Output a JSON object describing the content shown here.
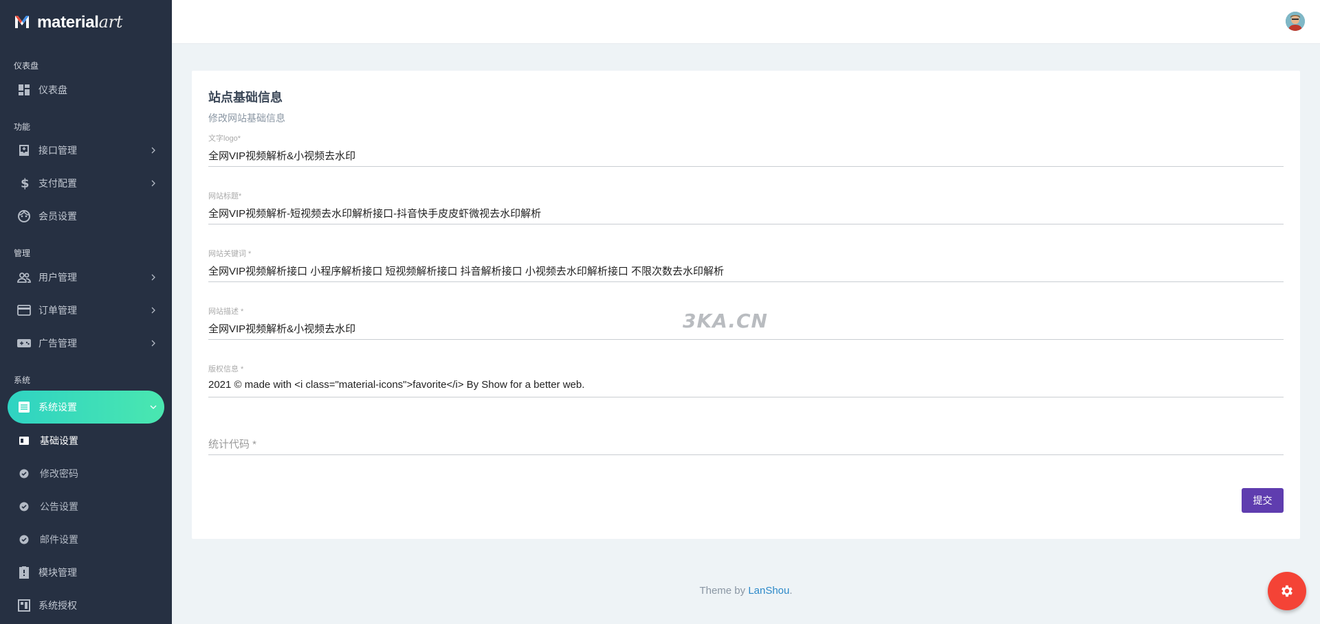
{
  "brand": {
    "name_bold": "material",
    "name_italic": "art"
  },
  "sidebar": {
    "sections": {
      "dashboard": "仪表盘",
      "features": "功能",
      "manage": "管理",
      "system": "系统"
    },
    "items": {
      "dashboard": "仪表盘",
      "api": "接口管理",
      "payment": "支付配置",
      "member": "会员设置",
      "users": "用户管理",
      "orders": "订单管理",
      "ads": "广告管理",
      "system_settings": "系统设置",
      "basic": "基础设置",
      "password": "修改密码",
      "notice": "公告设置",
      "mail": "邮件设置",
      "modules": "模块管理",
      "license": "系统授权"
    }
  },
  "card": {
    "title": "站点基础信息",
    "subtitle": "修改网站基础信息",
    "fields": {
      "logo": {
        "label": "文字logo*",
        "value": "全网VIP视频解析&小视频去水印"
      },
      "title": {
        "label": "网站标题*",
        "value": "全网VIP视频解析-短视频去水印解析接口-抖音快手皮皮虾微视去水印解析"
      },
      "keywords": {
        "label": "网站关键词 *",
        "value": "全网VIP视频解析接口 小程序解析接口 短视频解析接口 抖音解析接口 小视频去水印解析接口 不限次数去水印解析"
      },
      "description": {
        "label": "网站描述 *",
        "value": "全网VIP视频解析&小视频去水印"
      },
      "copyright": {
        "label": "版权信息 *",
        "value": "2021 © made with <i class=\"material-icons\">favorite</i> By Show for a better web."
      },
      "stats": {
        "placeholder": "统计代码 *"
      }
    },
    "submit_label": "提交"
  },
  "watermark": "3KA.CN",
  "footer": {
    "prefix": "Theme by ",
    "link": "LanShou",
    "suffix": "."
  },
  "colors": {
    "sidebar": "#263042",
    "accent_gradient_start": "#2fd3c2",
    "accent_gradient_end": "#4ae7b0",
    "submit": "#5f3daf",
    "fab": "#f44336",
    "link": "#2c89c9"
  },
  "icons": {
    "dashboard": "dashboard-icon",
    "api": "inbox-icon",
    "payment": "dollar-icon",
    "member": "face-icon",
    "users": "people-icon",
    "orders": "credit-card-icon",
    "ads": "gamepad-icon",
    "system_settings": "list-icon",
    "modules": "extension-icon",
    "license": "license-icon",
    "fab": "gear-icon"
  }
}
